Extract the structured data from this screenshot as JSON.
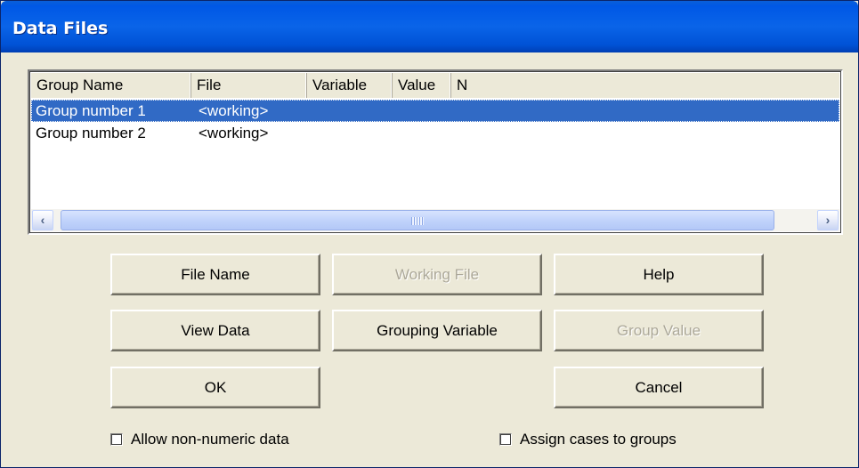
{
  "window": {
    "title": "Data Files"
  },
  "table": {
    "columns": [
      "Group Name",
      "File",
      "Variable",
      "Value",
      "N"
    ],
    "rows": [
      {
        "group_name": "Group number 1",
        "file": "<working>",
        "selected": true
      },
      {
        "group_name": "Group number 2",
        "file": "<working>",
        "selected": false
      }
    ],
    "scroll_left_glyph": "‹",
    "scroll_right_glyph": "›"
  },
  "buttons": {
    "file_name": "File Name",
    "working_file": "Working File",
    "help": "Help",
    "view_data": "View Data",
    "grouping_variable": "Grouping Variable",
    "group_value": "Group Value",
    "ok": "OK",
    "cancel": "Cancel"
  },
  "checkboxes": {
    "allow_non_numeric": {
      "label": "Allow non-numeric data",
      "checked": false
    },
    "assign_cases": {
      "label": "Assign cases to groups",
      "checked": false
    }
  },
  "colors": {
    "title_bar": "#0058e6",
    "selection": "#316ac5",
    "dialog_face": "#ece9d8"
  }
}
